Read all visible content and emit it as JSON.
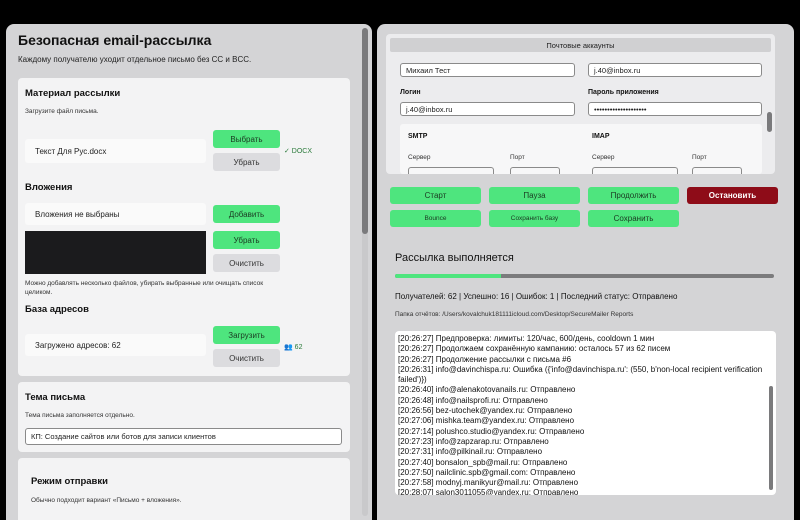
{
  "left": {
    "title": "Безопасная email-рассылка",
    "subtitle": "Каждому получателю уходит отдельное письмо без CC и BCC.",
    "material": {
      "title": "Материал рассылки",
      "hint": "Загрузите файл письма.",
      "file_name": "Текст Для Рус.docx",
      "choose_label": "Выбрать",
      "remove_label": "Убрать",
      "file_tag": "✓ DOCX"
    },
    "attachments": {
      "title": "Вложения",
      "status": "Вложения не выбраны",
      "add_label": "Добавить",
      "remove_label": "Убрать",
      "clear_label": "Очистить",
      "hint": "Можно добавлять несколько файлов, убирать выбранные или очищать список целиком."
    },
    "addresses": {
      "title": "База адресов",
      "status": "Загружено адресов: 62",
      "load_label": "Загрузить",
      "clear_label": "Очистить",
      "count_tag": "62"
    },
    "subject": {
      "title": "Тема письма",
      "hint": "Тема письма заполняется отдельно.",
      "value": "КП: Создание сайтов или ботов для записи клиентов"
    },
    "mode": {
      "title": "Режим отправки",
      "hint": "Обычно подходит вариант «Письмо + вложения»."
    }
  },
  "accounts": {
    "header": "Почтовые аккаунты",
    "name_value": "Михаил Тест",
    "email_value": "j.40@inbox.ru",
    "login_label": "Логин",
    "login_value": "j.40@inbox.ru",
    "password_label": "Пароль приложения",
    "password_value": "••••••••••••••••••••",
    "smtp_label": "SMTP",
    "imap_label": "IMAP",
    "server_label": "Сервер",
    "port_label": "Порт"
  },
  "controls": {
    "start": "Старт",
    "pause": "Пауза",
    "resume": "Продолжить",
    "stop": "Остановить",
    "bounce": "Bounce",
    "save_base": "Сохранить базу",
    "save": "Сохранить"
  },
  "progress_panel": {
    "title": "Рассылка выполняется",
    "progress": 0.28,
    "stats": "Получателей: 62 | Успешно: 16 | Ошибок: 1 | Последний статус: Отправлено",
    "reports": "Папка отчётов: /Users/kovalchuk181111icloud.com/Desktop/SecureMailer Reports"
  },
  "log": [
    "[20:26:27] Предпроверка: лимиты: 120/час, 600/день, cooldown 1 мин",
    "[20:26:27] Продолжаем сохранённую кампанию: осталось 57 из 62 писем",
    "[20:26:27] Продолжение рассылки с письма #6",
    "[20:26:31] info@davinchispa.ru: Ошибка ({'info@davinchispa.ru': (550, b'non-local recipient verification",
    "failed')})",
    "[20:26:40] info@alenakotovanails.ru: Отправлено",
    "[20:26:48] info@nailsprofi.ru: Отправлено",
    "[20:26:56] bez-utochek@yandex.ru: Отправлено",
    "[20:27:06] mishka.team@yandex.ru: Отправлено",
    "[20:27:14] polushco.studio@yandex.ru: Отправлено",
    "[20:27:23] info@zapzarap.ru: Отправлено",
    "[20:27:31] info@pilkinail.ru: Отправлено",
    "[20:27:40] bonsalon_spb@mail.ru: Отправлено",
    "[20:27:50] nailclinic.spb@gmail.com: Отправлено",
    "[20:27:58] modnyj.manikyur@mail.ru: Отправлено",
    "[20:28:07] salon3011055@yandex.ru: Отправлено"
  ],
  "colors": {
    "accent_green": "#4ee57e",
    "stop_red": "#8e0c18",
    "panel_bg": "#d4d4d6"
  }
}
